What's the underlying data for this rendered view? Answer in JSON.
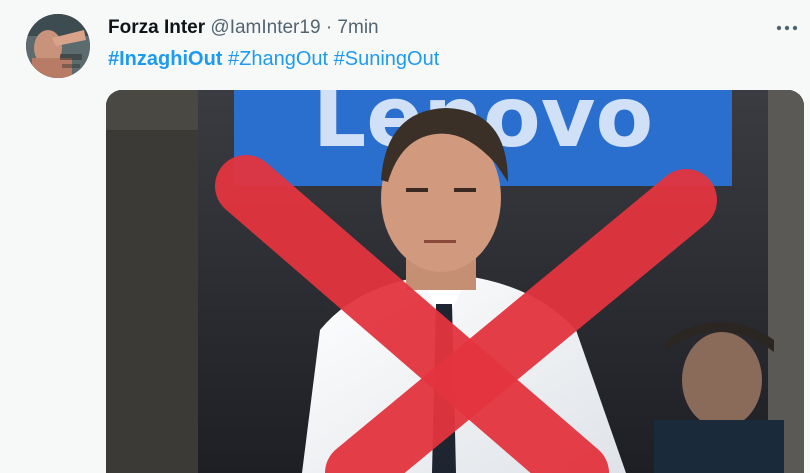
{
  "tweet": {
    "display_name": "Forza Inter",
    "handle": "@IamInter19",
    "separator": "·",
    "time": "7min",
    "hashtags": [
      {
        "text": "#InzaghiOut",
        "bold": true
      },
      {
        "text": "#ZhangOut",
        "bold": false
      },
      {
        "text": "#SuningOut",
        "bold": false
      }
    ],
    "more_icon": "more-horizontal-icon"
  },
  "media": {
    "background_sign_text": "Lenovo",
    "overlay_mark": "red-x",
    "colors": {
      "sign_blue": "#2a6fce",
      "x_red": "#e3343f",
      "link_blue": "#1d9bf0"
    }
  }
}
